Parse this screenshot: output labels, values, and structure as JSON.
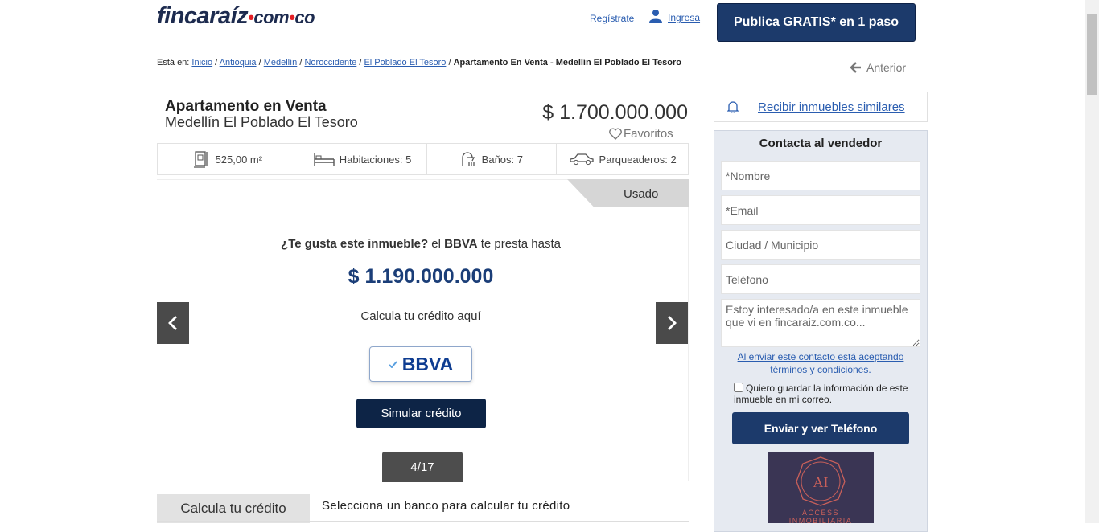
{
  "header": {
    "logo": {
      "brand": "fincaraíz",
      "tld": "com",
      "cc": "co"
    },
    "register_label": "Regístrate",
    "login_label": "Ingresa",
    "publish_label": "Publica GRATIS* en 1 paso"
  },
  "breadcrumb": {
    "prefix": "Está en:",
    "items": [
      "Inicio",
      "Antioquia",
      "Medellín",
      "Noroccidente",
      "El Poblado El Tesoro"
    ],
    "current": "Apartamento En Venta - Medellín El Poblado El Tesoro",
    "back_label": "Anterior"
  },
  "listing": {
    "title": "Apartamento en Venta",
    "location": "Medellín El Poblado El Tesoro",
    "price": "$ 1.700.000.000",
    "favorites_label": "Favoritos",
    "features": [
      {
        "icon": "area-icon",
        "label": "525,00 m²"
      },
      {
        "icon": "bed-icon",
        "label": "Habitaciones: 5"
      },
      {
        "icon": "shower-icon",
        "label": "Baños: 7"
      },
      {
        "icon": "car-icon",
        "label": "Parqueaderos: 2"
      }
    ],
    "condition_badge": "Usado"
  },
  "gallery": {
    "bbva_question": "¿Te gusta este inmueble?",
    "bbva_mid": "el",
    "bbva_bank": "BBVA",
    "bbva_tail": "te presta hasta",
    "bbva_amount": "$ 1.190.000.000",
    "calc_label": "Calcula tu crédito aquí",
    "bbva_logo_text": "BBVA",
    "simulate_label": "Simular crédito",
    "counter": "4/17"
  },
  "credit": {
    "tab_label": "Calcula tu crédito",
    "description": "Selecciona un banco para calcular tu crédito"
  },
  "sidebar": {
    "similar_label": "Recibir inmuebles similares",
    "contact_title": "Contacta al vendedor",
    "fields": {
      "name_placeholder": "*Nombre",
      "email_placeholder": "*Email",
      "city_placeholder": "Ciudad / Municipio",
      "phone_placeholder": "Teléfono",
      "message_placeholder": "Estoy interesado/a en este inmueble que vi en fincaraiz.com.co..."
    },
    "terms_label": "Al enviar este contacto está aceptando términos y condiciones.",
    "save_info_label": "Quiero guardar la información de este inmueble en mi correo.",
    "send_label": "Enviar y ver Teléfono",
    "agency_name": "ACCESS INMOBILIARIA",
    "agency_monogram": "AI"
  },
  "colors": {
    "navy": "#1c3a6b",
    "dark_navy": "#0d2446",
    "accent_red": "#e31e24",
    "bbva_blue": "#0f3d91",
    "link": "#2a5db0"
  }
}
